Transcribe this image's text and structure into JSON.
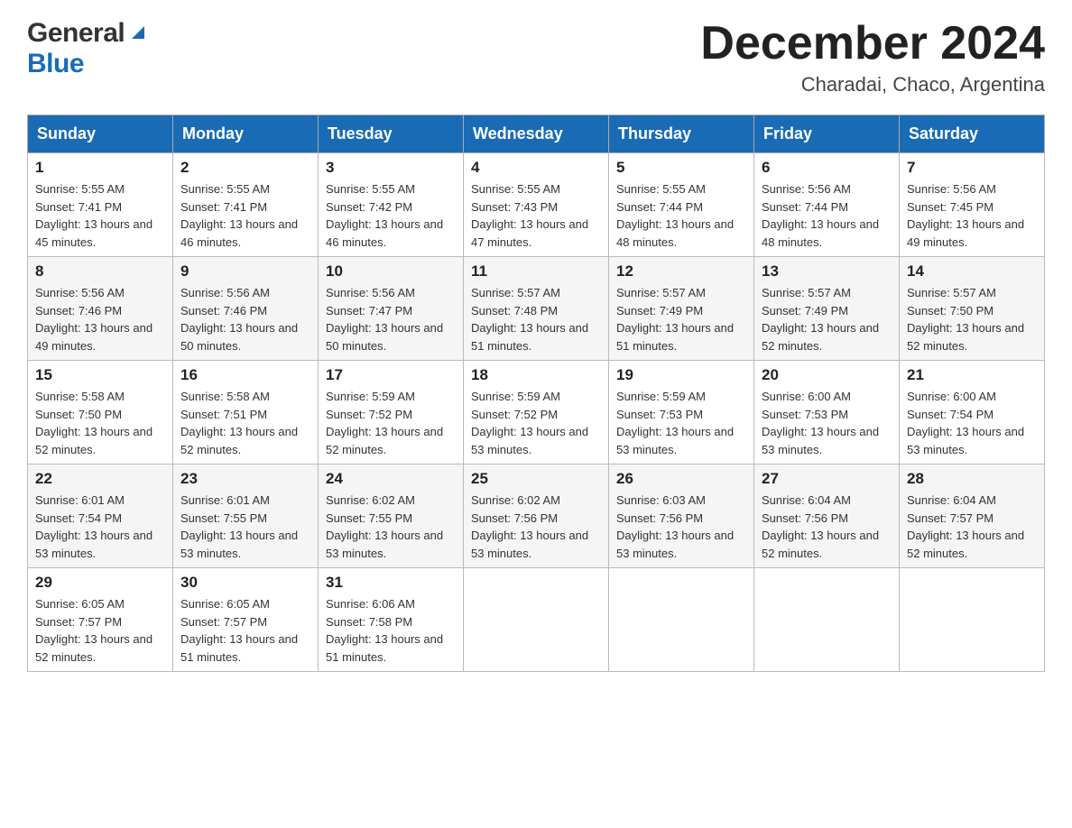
{
  "logo": {
    "general": "General",
    "blue": "Blue"
  },
  "title": {
    "month_year": "December 2024",
    "location": "Charadai, Chaco, Argentina"
  },
  "headers": [
    "Sunday",
    "Monday",
    "Tuesday",
    "Wednesday",
    "Thursday",
    "Friday",
    "Saturday"
  ],
  "weeks": [
    [
      {
        "day": "1",
        "sunrise": "5:55 AM",
        "sunset": "7:41 PM",
        "daylight": "13 hours and 45 minutes."
      },
      {
        "day": "2",
        "sunrise": "5:55 AM",
        "sunset": "7:41 PM",
        "daylight": "13 hours and 46 minutes."
      },
      {
        "day": "3",
        "sunrise": "5:55 AM",
        "sunset": "7:42 PM",
        "daylight": "13 hours and 46 minutes."
      },
      {
        "day": "4",
        "sunrise": "5:55 AM",
        "sunset": "7:43 PM",
        "daylight": "13 hours and 47 minutes."
      },
      {
        "day": "5",
        "sunrise": "5:55 AM",
        "sunset": "7:44 PM",
        "daylight": "13 hours and 48 minutes."
      },
      {
        "day": "6",
        "sunrise": "5:56 AM",
        "sunset": "7:44 PM",
        "daylight": "13 hours and 48 minutes."
      },
      {
        "day": "7",
        "sunrise": "5:56 AM",
        "sunset": "7:45 PM",
        "daylight": "13 hours and 49 minutes."
      }
    ],
    [
      {
        "day": "8",
        "sunrise": "5:56 AM",
        "sunset": "7:46 PM",
        "daylight": "13 hours and 49 minutes."
      },
      {
        "day": "9",
        "sunrise": "5:56 AM",
        "sunset": "7:46 PM",
        "daylight": "13 hours and 50 minutes."
      },
      {
        "day": "10",
        "sunrise": "5:56 AM",
        "sunset": "7:47 PM",
        "daylight": "13 hours and 50 minutes."
      },
      {
        "day": "11",
        "sunrise": "5:57 AM",
        "sunset": "7:48 PM",
        "daylight": "13 hours and 51 minutes."
      },
      {
        "day": "12",
        "sunrise": "5:57 AM",
        "sunset": "7:49 PM",
        "daylight": "13 hours and 51 minutes."
      },
      {
        "day": "13",
        "sunrise": "5:57 AM",
        "sunset": "7:49 PM",
        "daylight": "13 hours and 52 minutes."
      },
      {
        "day": "14",
        "sunrise": "5:57 AM",
        "sunset": "7:50 PM",
        "daylight": "13 hours and 52 minutes."
      }
    ],
    [
      {
        "day": "15",
        "sunrise": "5:58 AM",
        "sunset": "7:50 PM",
        "daylight": "13 hours and 52 minutes."
      },
      {
        "day": "16",
        "sunrise": "5:58 AM",
        "sunset": "7:51 PM",
        "daylight": "13 hours and 52 minutes."
      },
      {
        "day": "17",
        "sunrise": "5:59 AM",
        "sunset": "7:52 PM",
        "daylight": "13 hours and 52 minutes."
      },
      {
        "day": "18",
        "sunrise": "5:59 AM",
        "sunset": "7:52 PM",
        "daylight": "13 hours and 53 minutes."
      },
      {
        "day": "19",
        "sunrise": "5:59 AM",
        "sunset": "7:53 PM",
        "daylight": "13 hours and 53 minutes."
      },
      {
        "day": "20",
        "sunrise": "6:00 AM",
        "sunset": "7:53 PM",
        "daylight": "13 hours and 53 minutes."
      },
      {
        "day": "21",
        "sunrise": "6:00 AM",
        "sunset": "7:54 PM",
        "daylight": "13 hours and 53 minutes."
      }
    ],
    [
      {
        "day": "22",
        "sunrise": "6:01 AM",
        "sunset": "7:54 PM",
        "daylight": "13 hours and 53 minutes."
      },
      {
        "day": "23",
        "sunrise": "6:01 AM",
        "sunset": "7:55 PM",
        "daylight": "13 hours and 53 minutes."
      },
      {
        "day": "24",
        "sunrise": "6:02 AM",
        "sunset": "7:55 PM",
        "daylight": "13 hours and 53 minutes."
      },
      {
        "day": "25",
        "sunrise": "6:02 AM",
        "sunset": "7:56 PM",
        "daylight": "13 hours and 53 minutes."
      },
      {
        "day": "26",
        "sunrise": "6:03 AM",
        "sunset": "7:56 PM",
        "daylight": "13 hours and 53 minutes."
      },
      {
        "day": "27",
        "sunrise": "6:04 AM",
        "sunset": "7:56 PM",
        "daylight": "13 hours and 52 minutes."
      },
      {
        "day": "28",
        "sunrise": "6:04 AM",
        "sunset": "7:57 PM",
        "daylight": "13 hours and 52 minutes."
      }
    ],
    [
      {
        "day": "29",
        "sunrise": "6:05 AM",
        "sunset": "7:57 PM",
        "daylight": "13 hours and 52 minutes."
      },
      {
        "day": "30",
        "sunrise": "6:05 AM",
        "sunset": "7:57 PM",
        "daylight": "13 hours and 51 minutes."
      },
      {
        "day": "31",
        "sunrise": "6:06 AM",
        "sunset": "7:58 PM",
        "daylight": "13 hours and 51 minutes."
      },
      null,
      null,
      null,
      null
    ]
  ]
}
